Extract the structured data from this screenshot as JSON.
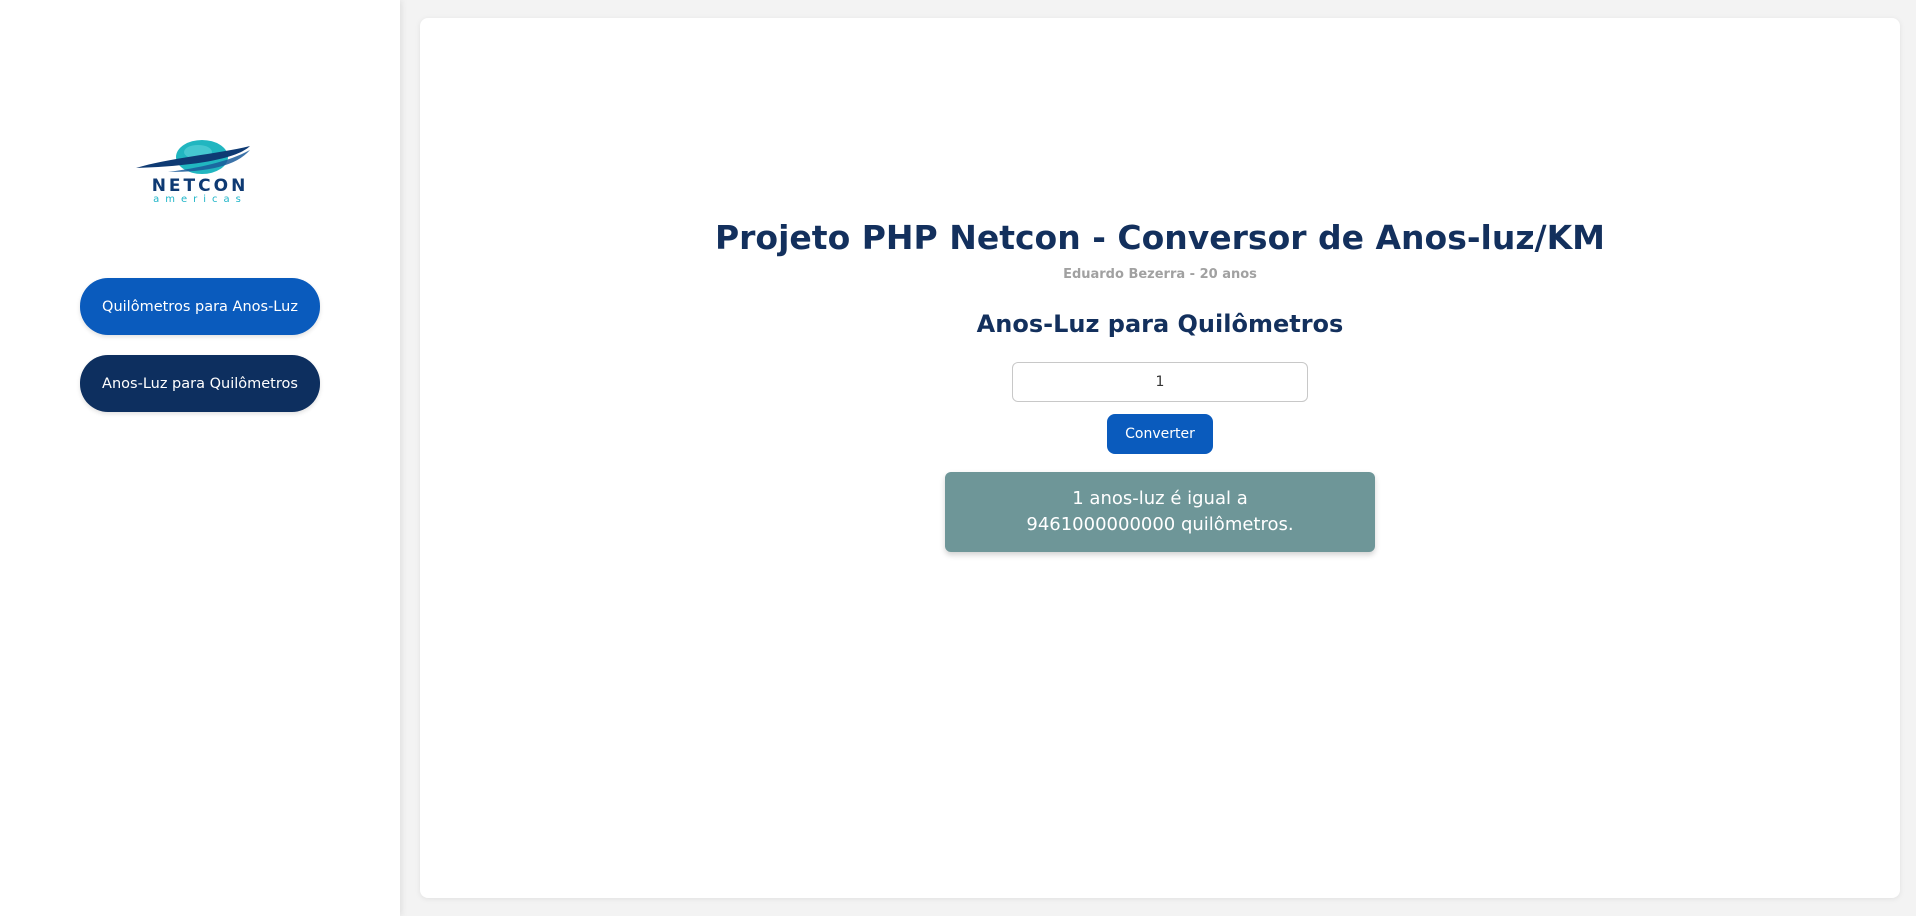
{
  "sidebar": {
    "logo": {
      "word": "NETCON",
      "sub": "americas",
      "colors": {
        "primary": "#0e3a73",
        "accent": "#1fb5c8"
      }
    },
    "buttons": [
      {
        "label": "Quilômetros para Anos-Luz",
        "color": "#0a5bbd"
      },
      {
        "label": "Anos-Luz para Quilômetros",
        "color": "#0d2f5f"
      }
    ]
  },
  "main": {
    "title": "Projeto PHP Netcon - Conversor de Anos-luz/KM",
    "subtitle": "Eduardo Bezerra - 20 anos",
    "section_title": "Anos-Luz para Quilômetros",
    "input": {
      "value": "1"
    },
    "convert_label": "Converter",
    "result_text": "1 anos-luz é igual a 9461000000000 quilômetros."
  }
}
